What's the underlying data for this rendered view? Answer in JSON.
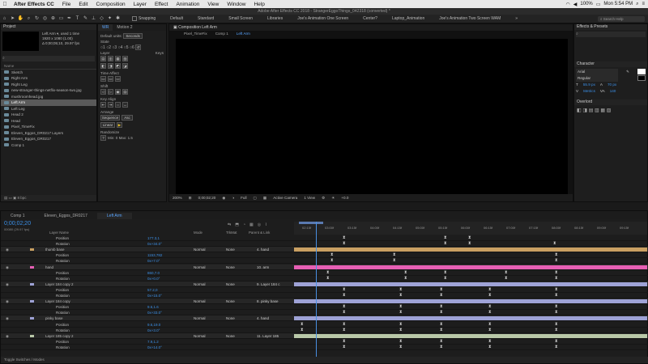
{
  "menubar": {
    "apple": "",
    "app_name": "After Effects CC",
    "items": [
      "File",
      "Edit",
      "Composition",
      "Layer",
      "Effect",
      "Animation",
      "View",
      "Window",
      "Help"
    ],
    "battery": "100%",
    "clock": "Mon 5:54 PM"
  },
  "window_title": "Adobe After Effects CC 2018 - StrangerEggoThings_042318 (converted) *",
  "toolbar": {
    "snapping_label": "Snapping",
    "workspaces": [
      "Default",
      "Standard",
      "Small Screen",
      "Libraries",
      "Joe's Animation One Screen",
      "Center?",
      "Laptop_Animation",
      "Joe's Animation Two Screen WAM"
    ],
    "search_placeholder": "Search Help"
  },
  "project_panel": {
    "title": "Project",
    "selected_name": "Left Arm ▾, used 1 time",
    "selected_info": [
      "1920 x 1080 (1.00)",
      "Δ 0;00;05;10, 29.97 fps"
    ],
    "search_placeholder": "",
    "column_name": "Name",
    "items": [
      {
        "label": "Sketch",
        "selected": false
      },
      {
        "label": "Right Arm",
        "selected": false
      },
      {
        "label": "Right Leg",
        "selected": false
      },
      {
        "label": "new-stranger-things-netflix-season-two.jpg",
        "selected": false
      },
      {
        "label": "mushroomhead.jpg",
        "selected": false
      },
      {
        "label": "Left Arm",
        "selected": true
      },
      {
        "label": "Left Leg",
        "selected": false
      },
      {
        "label": "Head 2",
        "selected": false
      },
      {
        "label": "Head",
        "selected": false
      },
      {
        "label": "Pixel_TimeFix",
        "selected": false
      },
      {
        "label": "Eleven_Eggos_DR0217 Layers",
        "selected": false
      },
      {
        "label": "Eleven_Eggos_DR0217",
        "selected": false
      },
      {
        "label": "Comp 1",
        "selected": false
      }
    ],
    "footer": "8 bpc"
  },
  "tools_panel": {
    "tabs": [
      "WR",
      "Motion 2"
    ],
    "default_units_label": "Default units:",
    "default_units_value": "Seconds",
    "state_label": "State",
    "layer_label": "Layer",
    "keys_label": "Keys",
    "time_affect_label": "Time Affect",
    "stagger_label": "Stagger",
    "shift_label": "Shift",
    "key_align_label": "Key Align",
    "arrange_label": "Arrange",
    "sequence_label": "Sequence",
    "asc_label": "Asc",
    "linear_label": "Linear",
    "randomize_label": "Randomize",
    "min_label": "Min:",
    "min_value": "0",
    "max_label": "Max:",
    "max_value": "1.5"
  },
  "viewer": {
    "tab_title": "Composition Left Arm",
    "breadcrumbs": [
      "Pixel_TimeFix",
      "Comp 1",
      "Left Arm"
    ],
    "zoom": "200%",
    "timecode": "0;00;02;20",
    "resolution": "Full",
    "camera": "Active Camera",
    "views": "1 View",
    "offset": "+0.0"
  },
  "effects_panel": {
    "title": "Effects & Presets",
    "search_placeholder": ""
  },
  "character_panel": {
    "title": "Character",
    "font": "Arial",
    "style": "Regular",
    "size": "55.9 px",
    "leading": "70 px",
    "kerning": "Metrics",
    "tracking": "140",
    "overlord_title": "Overlord"
  },
  "timeline": {
    "tabs": [
      "Comp 1",
      "Eleven_Eggos_DR0217",
      "Left Arm"
    ],
    "active_tab": "Left Arm",
    "timecode": "0;00;02;20",
    "timecode_sub": "00080 (29.97 fps)",
    "col_source": "Layer Name",
    "col_mode": "Mode",
    "col_trkmat": "TrkMat",
    "col_parent": "Parent & Link",
    "ruler_labels": [
      "02:15f",
      "03:00f",
      "03:15f",
      "04:00f",
      "04:15f",
      "05:00f",
      "05:15f",
      "06:00f",
      "06:15f",
      "07:00f",
      "07:15f",
      "08:00f",
      "08:15f",
      "09:00f",
      "09:15f"
    ],
    "footer_label": "Toggle Switches / Modes",
    "rows": [
      {
        "type": "prop",
        "name": "Position",
        "value": "177.3,1"
      },
      {
        "type": "prop",
        "name": "Rotation",
        "value": "0x+34.0°"
      },
      {
        "type": "layer",
        "name": "thumb base",
        "color": "#c9a062",
        "mode": "Normal",
        "trk": "None",
        "parent": "4. hand",
        "barcolor": "#c9a062"
      },
      {
        "type": "prop",
        "name": "Position",
        "value": "1153,782"
      },
      {
        "type": "prop",
        "name": "Rotation",
        "value": "0x+7.0°"
      },
      {
        "type": "layer",
        "name": "hand",
        "color": "#e65fb4",
        "mode": "Normal",
        "trk": "None",
        "parent": "10. arm",
        "barcolor": "#e65fb4"
      },
      {
        "type": "prop",
        "name": "Position",
        "value": "860,7.0"
      },
      {
        "type": "prop",
        "name": "Rotation",
        "value": "0x+0.0°"
      },
      {
        "type": "layer",
        "name": "Layer 184 copy 2",
        "color": "#9ea2d6",
        "mode": "Normal",
        "trk": "None",
        "parent": "9. Layer 184 c",
        "barcolor": "#9ea2d6"
      },
      {
        "type": "prop",
        "name": "Position",
        "value": "57.2,0"
      },
      {
        "type": "prop",
        "name": "Rotation",
        "value": "0x+15.0°"
      },
      {
        "type": "layer",
        "name": "Layer 184 copy",
        "color": "#9ea2d6",
        "mode": "Normal",
        "trk": "None",
        "parent": "8. pinky base",
        "barcolor": "#9ea2d6"
      },
      {
        "type": "prop",
        "name": "Position",
        "value": "9.6,1.6"
      },
      {
        "type": "prop",
        "name": "Rotation",
        "value": "0x+33.0°"
      },
      {
        "type": "layer",
        "name": "pinky base",
        "color": "#9ea2d6",
        "mode": "Normal",
        "trk": "None",
        "parent": "4. hand",
        "barcolor": "#9ea2d6"
      },
      {
        "type": "prop",
        "name": "Position",
        "value": "9.6,19.0"
      },
      {
        "type": "prop",
        "name": "Rotation",
        "value": "0x+3.0°"
      },
      {
        "type": "layer",
        "name": "Layer 185 copy 2",
        "color": "#b9c8a8",
        "mode": "Normal",
        "trk": "None",
        "parent": "11. Layer 185",
        "barcolor": "#b9c8a8"
      },
      {
        "type": "prop",
        "name": "Position",
        "value": "7.9,1.2"
      },
      {
        "type": "prop",
        "name": "Rotation",
        "value": "0x+14.0°"
      }
    ]
  },
  "colors": {
    "accent": "#3b8fe6",
    "playhead": "#4a90e2",
    "keyframe": "#dddddd"
  }
}
